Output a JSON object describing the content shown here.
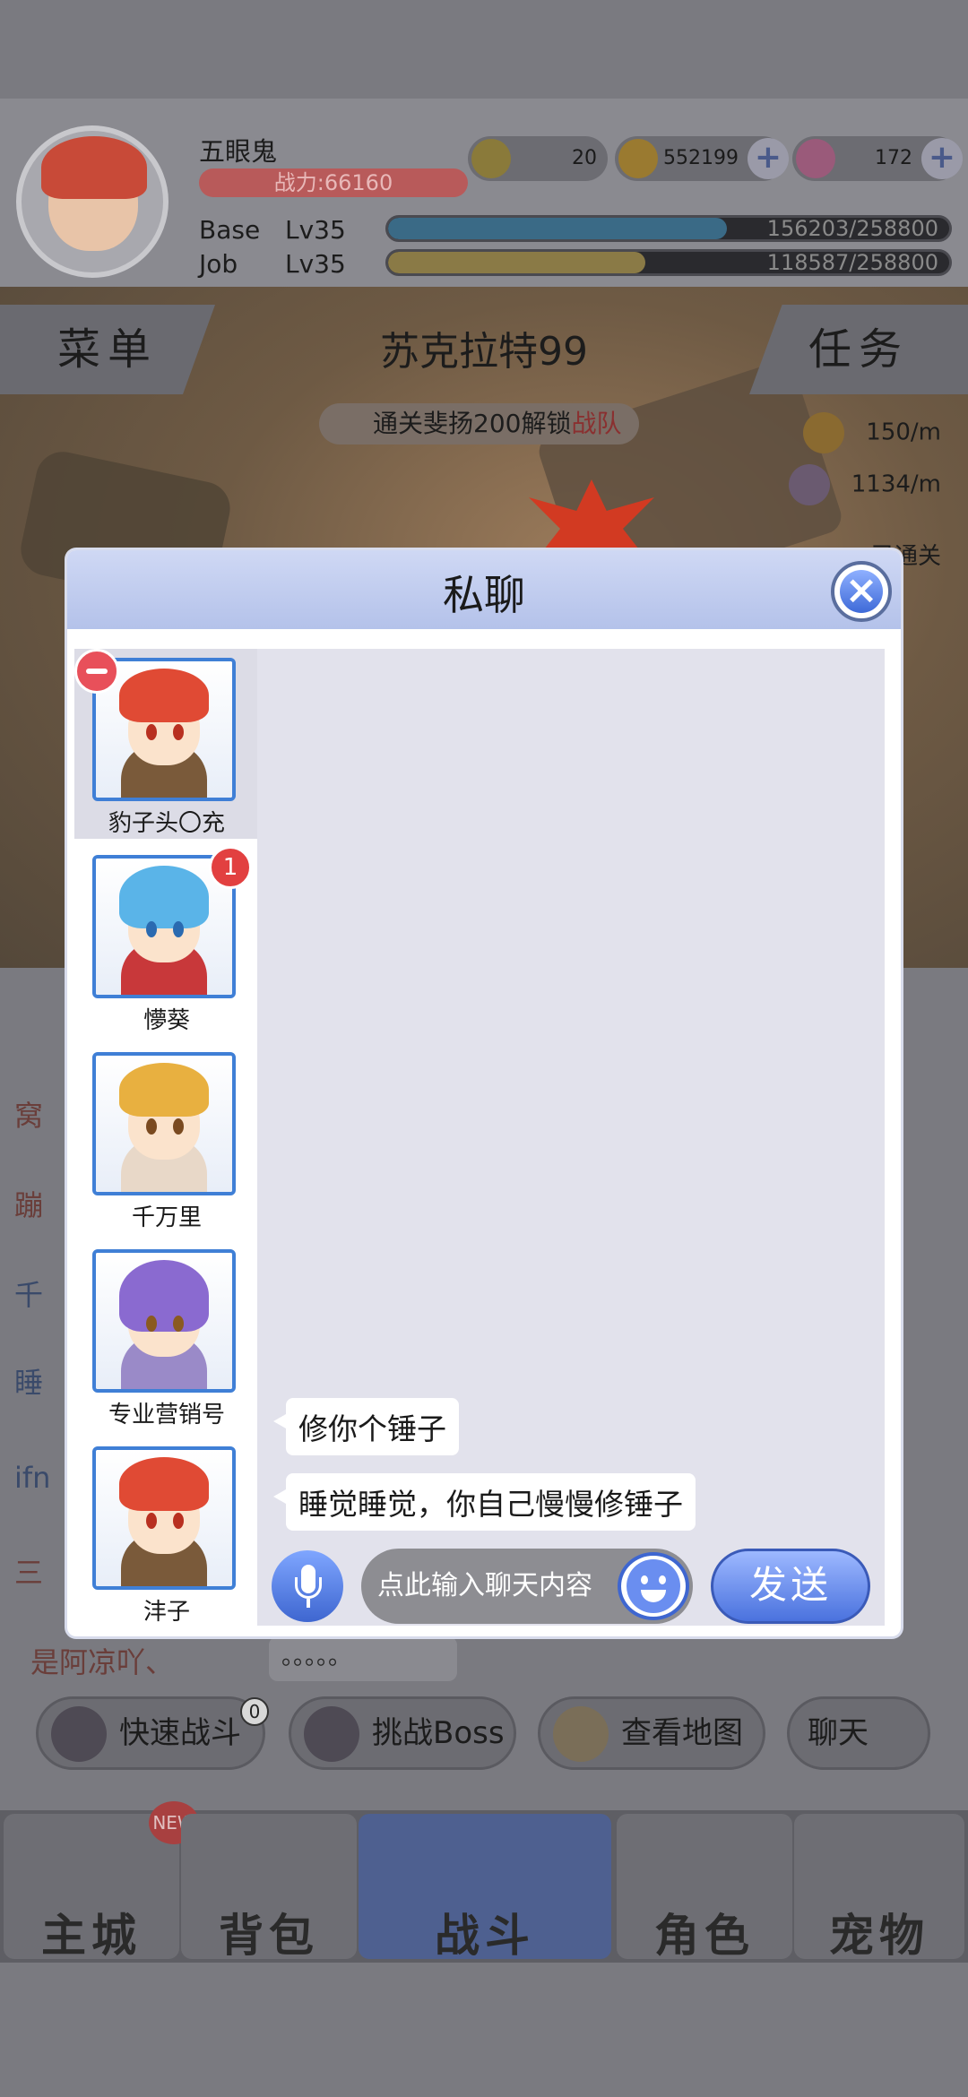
{
  "player": {
    "name": "五眼鬼",
    "power": "战力:66160",
    "base_label": "Base",
    "base_level": "Lv35",
    "base_exp": "156203/258800",
    "base_progress": 0.604,
    "job_label": "Job",
    "job_level": "Lv35",
    "job_exp": "118587/258800",
    "job_progress": 0.458
  },
  "currencies": {
    "zeny": "20",
    "coins": "552199",
    "gems": "172"
  },
  "top_nav": {
    "menu": "菜单",
    "map_name": "苏克拉特99",
    "tasks": "任务",
    "unlock_tip_prefix": "通关斐扬200解锁",
    "unlock_tip_highlight": "战队",
    "gold_rate": "150/m",
    "exp_rate": "1134/m",
    "auto_clear": "已通关"
  },
  "background_chat": {
    "lines": [
      "窝",
      "蹦",
      "千",
      "睡",
      "ifn",
      "三"
    ],
    "last_sender": "是阿凉吖、",
    "last_message": "。。。。。"
  },
  "action_buttons": {
    "quick_battle": "快速战斗",
    "quick_battle_count": "0",
    "challenge_boss": "挑战Boss",
    "view_map": "查看地图",
    "chat": "聊天"
  },
  "bottom_nav": {
    "items": [
      "主城",
      "背包",
      "战斗",
      "角色",
      "宠物"
    ],
    "new_badge": "NEW"
  },
  "modal": {
    "title": "私聊",
    "contacts": [
      {
        "name": "豹子头〇充",
        "badge": ""
      },
      {
        "name": "懜葵",
        "badge": "1"
      },
      {
        "name": "千万里",
        "badge": ""
      },
      {
        "name": "专业营销号",
        "badge": ""
      },
      {
        "name": "沣子",
        "badge": ""
      }
    ],
    "messages": [
      "修你个锤子",
      "睡觉睡觉，你自己慢慢修锤子"
    ],
    "input_placeholder": "点此输入聊天内容",
    "send_label": "发送"
  }
}
